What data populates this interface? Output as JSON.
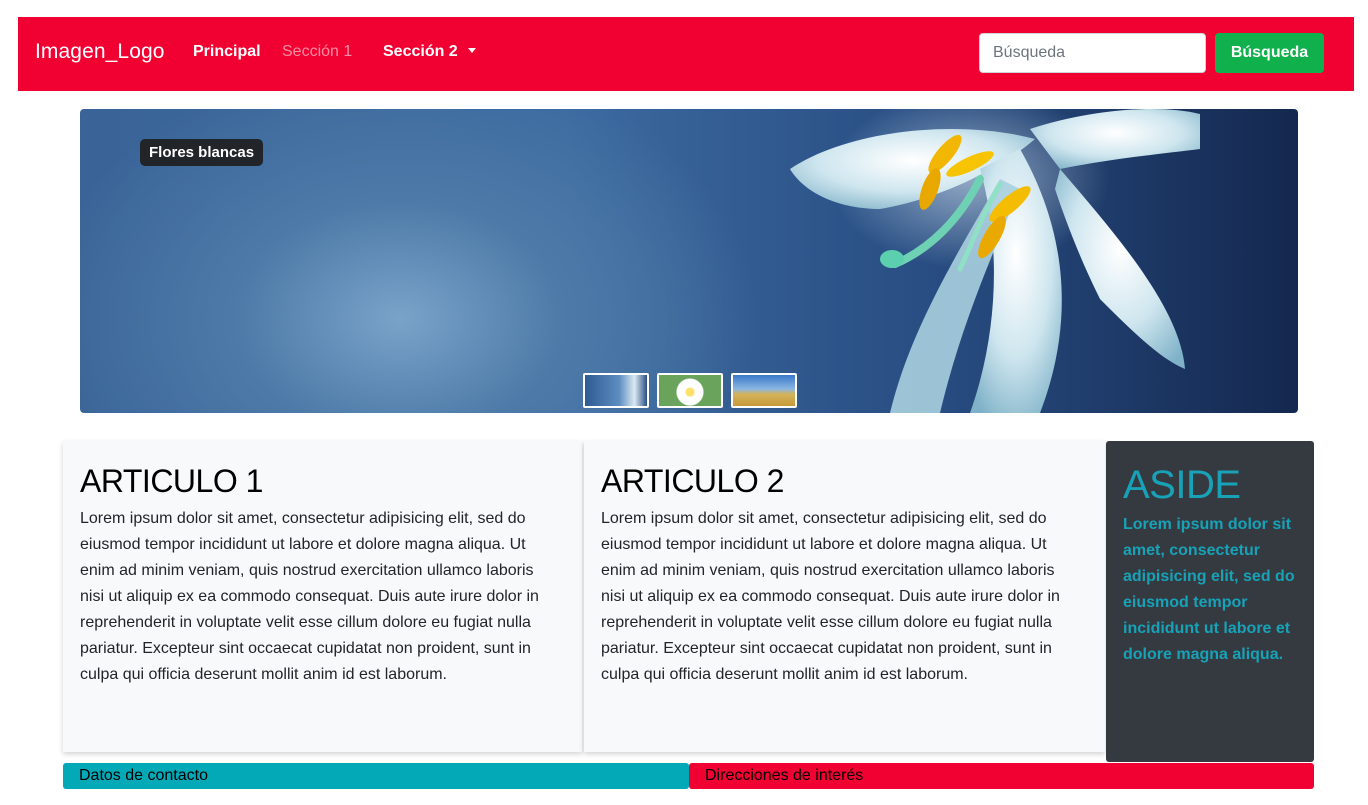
{
  "navbar": {
    "brand": "Imagen_Logo",
    "links": [
      {
        "label": "Principal"
      },
      {
        "label": "Sección 1"
      },
      {
        "label": "Sección 2"
      }
    ],
    "search": {
      "placeholder": "Búsqueda",
      "value": "",
      "button_label": "Búsqueda"
    },
    "colors": {
      "background": "#f10032",
      "button": "#10b04d"
    }
  },
  "carousel": {
    "caption": "Flores blancas",
    "thumbnail_count": 3,
    "active_index": 0
  },
  "articles": [
    {
      "title": "ARTICULO 1",
      "body": "Lorem ipsum dolor sit amet, consectetur adipisicing elit, sed do eiusmod tempor incididunt ut labore et dolore magna aliqua. Ut enim ad minim veniam, quis nostrud exercitation ullamco laboris nisi ut aliquip ex ea commodo consequat. Duis aute irure dolor in reprehenderit in voluptate velit esse cillum dolore eu fugiat nulla pariatur. Excepteur sint occaecat cupidatat non proident, sunt in culpa qui officia deserunt mollit anim id est laborum."
    },
    {
      "title": "ARTICULO 2",
      "body": "Lorem ipsum dolor sit amet, consectetur adipisicing elit, sed do eiusmod tempor incididunt ut labore et dolore magna aliqua. Ut enim ad minim veniam, quis nostrud exercitation ullamco laboris nisi ut aliquip ex ea commodo consequat. Duis aute irure dolor in reprehenderit in voluptate velit esse cillum dolore eu fugiat nulla pariatur. Excepteur sint occaecat cupidatat non proident, sunt in culpa qui officia deserunt mollit anim id est laborum."
    }
  ],
  "aside": {
    "title": "ASIDE",
    "body": "Lorem ipsum dolor sit amet, consectetur adipisicing elit, sed do eiusmod tempor incididunt ut labore et dolore magna aliqua.",
    "colors": {
      "background": "#343a40",
      "text": "#17a2b8"
    }
  },
  "footer": {
    "left_label": "Datos de contacto",
    "right_label": "Direcciones de interés",
    "colors": {
      "left": "#04a9b7",
      "right": "#f10032"
    }
  }
}
